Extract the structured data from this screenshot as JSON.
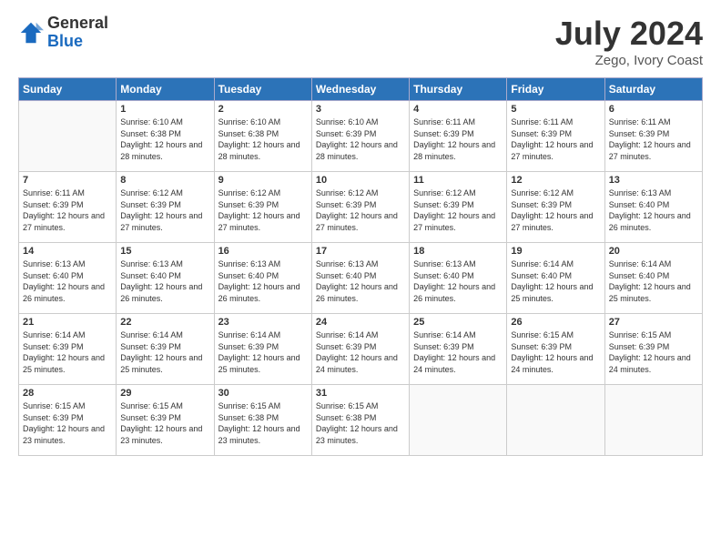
{
  "header": {
    "logo_general": "General",
    "logo_blue": "Blue",
    "main_title": "July 2024",
    "subtitle": "Zego, Ivory Coast"
  },
  "days_of_week": [
    "Sunday",
    "Monday",
    "Tuesday",
    "Wednesday",
    "Thursday",
    "Friday",
    "Saturday"
  ],
  "weeks": [
    [
      {
        "day": "",
        "sunrise": "",
        "sunset": "",
        "daylight": ""
      },
      {
        "day": "1",
        "sunrise": "Sunrise: 6:10 AM",
        "sunset": "Sunset: 6:38 PM",
        "daylight": "Daylight: 12 hours and 28 minutes."
      },
      {
        "day": "2",
        "sunrise": "Sunrise: 6:10 AM",
        "sunset": "Sunset: 6:38 PM",
        "daylight": "Daylight: 12 hours and 28 minutes."
      },
      {
        "day": "3",
        "sunrise": "Sunrise: 6:10 AM",
        "sunset": "Sunset: 6:39 PM",
        "daylight": "Daylight: 12 hours and 28 minutes."
      },
      {
        "day": "4",
        "sunrise": "Sunrise: 6:11 AM",
        "sunset": "Sunset: 6:39 PM",
        "daylight": "Daylight: 12 hours and 28 minutes."
      },
      {
        "day": "5",
        "sunrise": "Sunrise: 6:11 AM",
        "sunset": "Sunset: 6:39 PM",
        "daylight": "Daylight: 12 hours and 27 minutes."
      },
      {
        "day": "6",
        "sunrise": "Sunrise: 6:11 AM",
        "sunset": "Sunset: 6:39 PM",
        "daylight": "Daylight: 12 hours and 27 minutes."
      }
    ],
    [
      {
        "day": "7",
        "sunrise": "Sunrise: 6:11 AM",
        "sunset": "Sunset: 6:39 PM",
        "daylight": "Daylight: 12 hours and 27 minutes."
      },
      {
        "day": "8",
        "sunrise": "Sunrise: 6:12 AM",
        "sunset": "Sunset: 6:39 PM",
        "daylight": "Daylight: 12 hours and 27 minutes."
      },
      {
        "day": "9",
        "sunrise": "Sunrise: 6:12 AM",
        "sunset": "Sunset: 6:39 PM",
        "daylight": "Daylight: 12 hours and 27 minutes."
      },
      {
        "day": "10",
        "sunrise": "Sunrise: 6:12 AM",
        "sunset": "Sunset: 6:39 PM",
        "daylight": "Daylight: 12 hours and 27 minutes."
      },
      {
        "day": "11",
        "sunrise": "Sunrise: 6:12 AM",
        "sunset": "Sunset: 6:39 PM",
        "daylight": "Daylight: 12 hours and 27 minutes."
      },
      {
        "day": "12",
        "sunrise": "Sunrise: 6:12 AM",
        "sunset": "Sunset: 6:39 PM",
        "daylight": "Daylight: 12 hours and 27 minutes."
      },
      {
        "day": "13",
        "sunrise": "Sunrise: 6:13 AM",
        "sunset": "Sunset: 6:40 PM",
        "daylight": "Daylight: 12 hours and 26 minutes."
      }
    ],
    [
      {
        "day": "14",
        "sunrise": "Sunrise: 6:13 AM",
        "sunset": "Sunset: 6:40 PM",
        "daylight": "Daylight: 12 hours and 26 minutes."
      },
      {
        "day": "15",
        "sunrise": "Sunrise: 6:13 AM",
        "sunset": "Sunset: 6:40 PM",
        "daylight": "Daylight: 12 hours and 26 minutes."
      },
      {
        "day": "16",
        "sunrise": "Sunrise: 6:13 AM",
        "sunset": "Sunset: 6:40 PM",
        "daylight": "Daylight: 12 hours and 26 minutes."
      },
      {
        "day": "17",
        "sunrise": "Sunrise: 6:13 AM",
        "sunset": "Sunset: 6:40 PM",
        "daylight": "Daylight: 12 hours and 26 minutes."
      },
      {
        "day": "18",
        "sunrise": "Sunrise: 6:13 AM",
        "sunset": "Sunset: 6:40 PM",
        "daylight": "Daylight: 12 hours and 26 minutes."
      },
      {
        "day": "19",
        "sunrise": "Sunrise: 6:14 AM",
        "sunset": "Sunset: 6:40 PM",
        "daylight": "Daylight: 12 hours and 25 minutes."
      },
      {
        "day": "20",
        "sunrise": "Sunrise: 6:14 AM",
        "sunset": "Sunset: 6:40 PM",
        "daylight": "Daylight: 12 hours and 25 minutes."
      }
    ],
    [
      {
        "day": "21",
        "sunrise": "Sunrise: 6:14 AM",
        "sunset": "Sunset: 6:39 PM",
        "daylight": "Daylight: 12 hours and 25 minutes."
      },
      {
        "day": "22",
        "sunrise": "Sunrise: 6:14 AM",
        "sunset": "Sunset: 6:39 PM",
        "daylight": "Daylight: 12 hours and 25 minutes."
      },
      {
        "day": "23",
        "sunrise": "Sunrise: 6:14 AM",
        "sunset": "Sunset: 6:39 PM",
        "daylight": "Daylight: 12 hours and 25 minutes."
      },
      {
        "day": "24",
        "sunrise": "Sunrise: 6:14 AM",
        "sunset": "Sunset: 6:39 PM",
        "daylight": "Daylight: 12 hours and 24 minutes."
      },
      {
        "day": "25",
        "sunrise": "Sunrise: 6:14 AM",
        "sunset": "Sunset: 6:39 PM",
        "daylight": "Daylight: 12 hours and 24 minutes."
      },
      {
        "day": "26",
        "sunrise": "Sunrise: 6:15 AM",
        "sunset": "Sunset: 6:39 PM",
        "daylight": "Daylight: 12 hours and 24 minutes."
      },
      {
        "day": "27",
        "sunrise": "Sunrise: 6:15 AM",
        "sunset": "Sunset: 6:39 PM",
        "daylight": "Daylight: 12 hours and 24 minutes."
      }
    ],
    [
      {
        "day": "28",
        "sunrise": "Sunrise: 6:15 AM",
        "sunset": "Sunset: 6:39 PM",
        "daylight": "Daylight: 12 hours and 23 minutes."
      },
      {
        "day": "29",
        "sunrise": "Sunrise: 6:15 AM",
        "sunset": "Sunset: 6:39 PM",
        "daylight": "Daylight: 12 hours and 23 minutes."
      },
      {
        "day": "30",
        "sunrise": "Sunrise: 6:15 AM",
        "sunset": "Sunset: 6:38 PM",
        "daylight": "Daylight: 12 hours and 23 minutes."
      },
      {
        "day": "31",
        "sunrise": "Sunrise: 6:15 AM",
        "sunset": "Sunset: 6:38 PM",
        "daylight": "Daylight: 12 hours and 23 minutes."
      },
      {
        "day": "",
        "sunrise": "",
        "sunset": "",
        "daylight": ""
      },
      {
        "day": "",
        "sunrise": "",
        "sunset": "",
        "daylight": ""
      },
      {
        "day": "",
        "sunrise": "",
        "sunset": "",
        "daylight": ""
      }
    ]
  ]
}
